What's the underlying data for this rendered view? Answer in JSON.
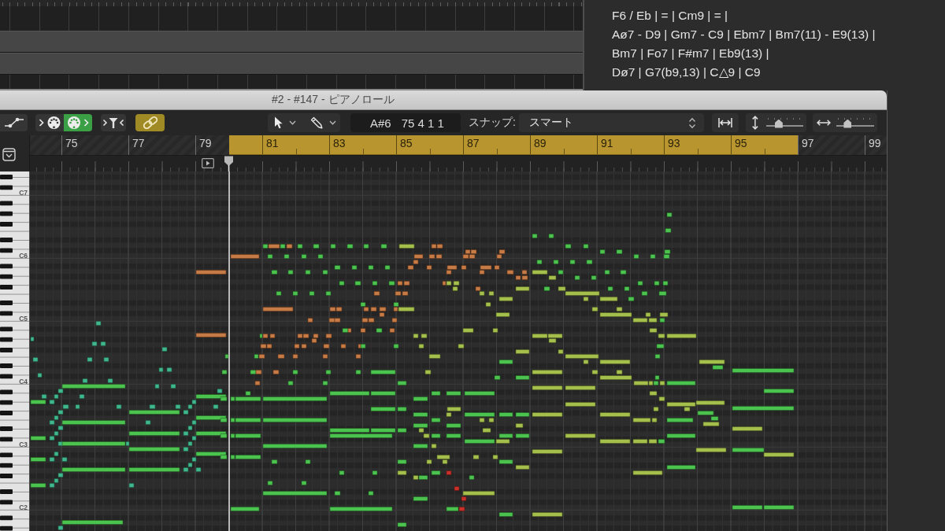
{
  "chord_sheet": {
    "lines": [
      "F6 / Eb | = | Cm9 | = |",
      "Aø7 - D9 | Gm7 - C9 | Ebm7 | Bm7(11) - E9(13) |",
      "Bm7 | Fo7 | F#m7 | Eb9(13) |",
      "Dø7 | G7(b9,13) | C△9 | C9"
    ]
  },
  "piano_roll": {
    "title": "#2 - #147 - ピアノロール",
    "toolbar": {
      "toggles": [
        {
          "kind": "automation",
          "on": false
        },
        {
          "kind": "midi_in",
          "on": false
        },
        {
          "kind": "midi_out",
          "on": true
        },
        {
          "kind": "midi_filter",
          "on": false
        },
        {
          "kind": "link",
          "on": true
        }
      ],
      "tools": [
        {
          "kind": "pointer"
        },
        {
          "kind": "pencil"
        }
      ],
      "position": {
        "pitch": "A#6",
        "time": "75 4 1 1"
      },
      "snap": {
        "label": "スナップ:",
        "value": "スマート"
      },
      "zoom_sliders": [
        {
          "kind": "vertical",
          "level": 0.3
        },
        {
          "kind": "horizontal",
          "level": 0.25
        }
      ]
    },
    "ruler": {
      "bars": [
        "75",
        "77",
        "79",
        "81",
        "83",
        "85",
        "87",
        "89",
        "91",
        "93",
        "95",
        "97",
        "99"
      ],
      "cycle_on": true
    },
    "keyboard": {
      "octave_labels": [
        "C7",
        "C6",
        "C5",
        "C4",
        "C3",
        "C2"
      ]
    }
  }
}
